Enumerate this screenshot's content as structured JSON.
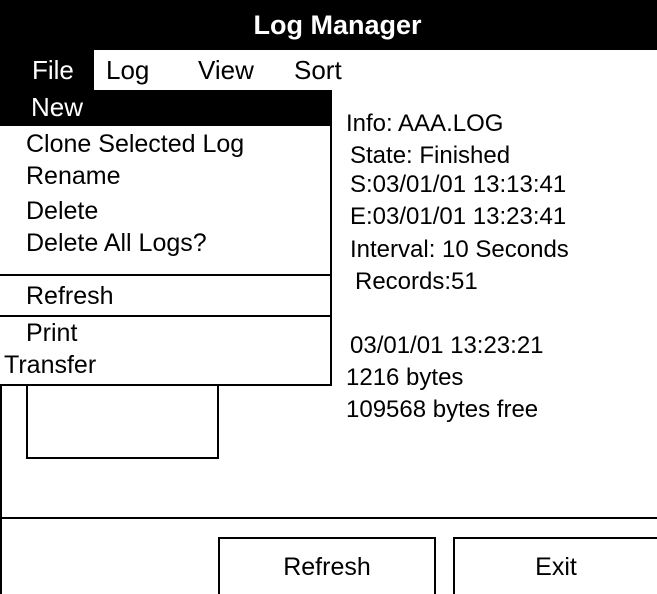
{
  "window": {
    "title": "Log Manager"
  },
  "menubar": {
    "file": "File",
    "log": "Log",
    "view": "View",
    "sort": "Sort"
  },
  "file_menu": {
    "new": "New",
    "clone": "Clone Selected Log",
    "rename": "Rename",
    "delete": "Delete",
    "delete_all": "Delete All Logs?",
    "refresh": "Refresh",
    "print": "Print",
    "transfer": "Transfer"
  },
  "info": {
    "name": "Info: AAA.LOG",
    "state": "State: Finished",
    "start": "S:03/01/01 13:13:41",
    "end": "E:03/01/01 13:23:41",
    "interval": "Interval: 10 Seconds",
    "records": "Records:51",
    "timestamp": "03/01/01 13:23:21",
    "size": "1216 bytes",
    "free": "109568 bytes free"
  },
  "buttons": {
    "refresh": "Refresh",
    "exit": "Exit"
  }
}
